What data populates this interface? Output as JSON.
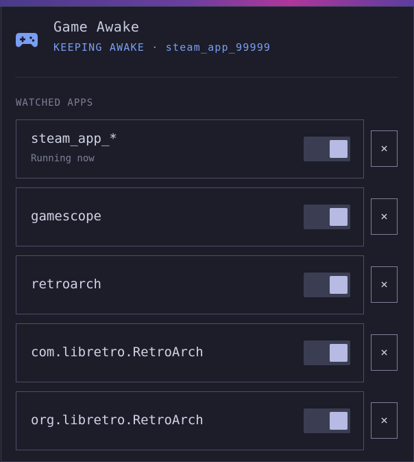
{
  "header": {
    "title": "Game Awake",
    "subtitle": "KEEPING AWAKE · steam_app_99999"
  },
  "section": {
    "label": "WATCHED APPS"
  },
  "apps": [
    {
      "name": "steam_app_*",
      "status": "Running now",
      "enabled": true,
      "remove_label": "×"
    },
    {
      "name": "gamescope",
      "status": "",
      "enabled": true,
      "remove_label": "×"
    },
    {
      "name": "retroarch",
      "status": "",
      "enabled": true,
      "remove_label": "×"
    },
    {
      "name": "com.libretro.RetroArch",
      "status": "",
      "enabled": true,
      "remove_label": "×"
    },
    {
      "name": "org.libretro.RetroArch",
      "status": "",
      "enabled": true,
      "remove_label": "×"
    }
  ],
  "colors": {
    "accent": "#7a9ef5",
    "toggle_on_knob": "#b7bbe3",
    "background": "#1c1d28"
  },
  "icons": {
    "app": "gamepad-icon"
  }
}
